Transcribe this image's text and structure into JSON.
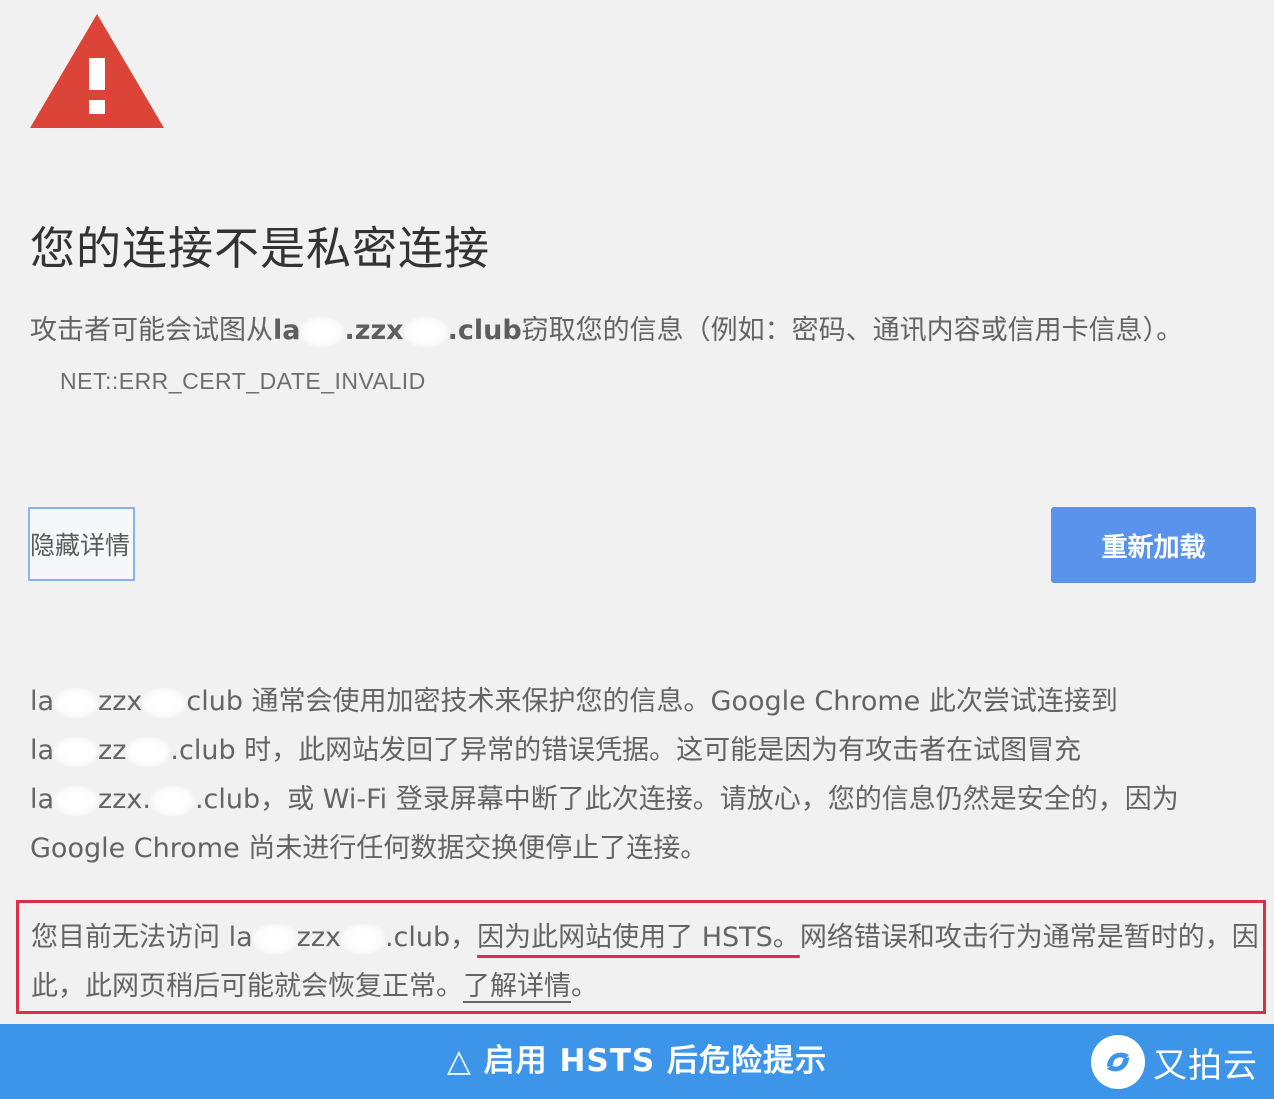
{
  "title": "您的连接不是私密连接",
  "intro": {
    "before": "攻击者可能会试图从",
    "host_prefix": "la",
    "host_mid": ".zzx",
    "host_suffix": ".club",
    "after": "窃取您的信息（例如：密码、通讯内容或信用卡信息）。",
    "error_code": "NET::ERR_CERT_DATE_INVALID"
  },
  "buttons": {
    "details": "隐藏详情",
    "reload": "重新加载"
  },
  "details": {
    "line1_host_a": "la",
    "line1_host_b": "zzx",
    "line1_text": "club 通常会使用加密技术来保护您的信息。Google Chrome 此次尝试连接到",
    "line2_host_a": "la",
    "line2_host_b": "zz",
    "line2_text": ".club 时，此网站发回了异常的错误凭据。这可能是因为有攻击者在试图冒充",
    "line3_host_a": "la",
    "line3_host_b": "zzx.",
    "line3_text": ".club，或 Wi-Fi 登录屏幕中断了此次连接。请放心，您的信息仍然是安全的，因为 Google Chrome 尚未进行任何数据交换便停止了连接。"
  },
  "hsts": {
    "before": "您目前无法访问 la",
    "host_b": "zzx",
    "host_c": ".club，",
    "underlined": "因为此网站使用了 HSTS。",
    "after": "网络错误和攻击行为通常是暂时的，因此，此网页稍后可能就会恢复正常。",
    "learn_more": "了解详情",
    "end": "。"
  },
  "banner": {
    "caption": "△ 启用 HSTS 后危险提示",
    "brand": "又拍云"
  },
  "colors": {
    "warning_red": "#db4437",
    "reload_blue": "#5a93ec",
    "highlight_red": "#d93043",
    "banner_blue": "#3d95ea"
  }
}
